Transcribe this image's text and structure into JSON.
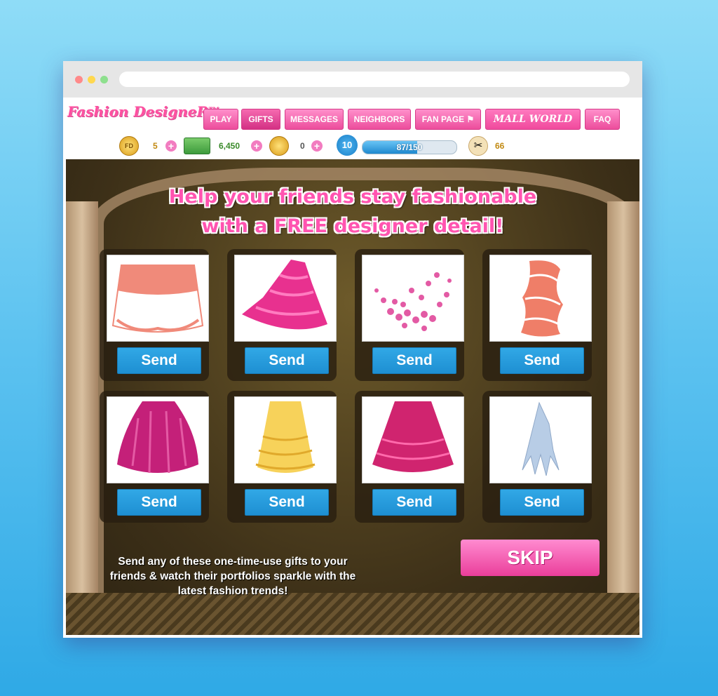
{
  "app": {
    "logo": "Fashion DesigneR",
    "trademark": "TM"
  },
  "nav": [
    {
      "label": "PLAY"
    },
    {
      "label": "GIFTS"
    },
    {
      "label": "MESSAGES"
    },
    {
      "label": "NEIGHBORS"
    },
    {
      "label": "FAN PAGE"
    },
    {
      "label": "MALL WORLD"
    },
    {
      "label": "FAQ"
    }
  ],
  "stats": {
    "fd_coin_label": "FD",
    "fd_coins": "5",
    "cash": "6,450",
    "facebook_credits": "0",
    "level": "10",
    "xp_text": "87/150",
    "xp_fraction": 0.58,
    "scissors": "66"
  },
  "headline": {
    "line1": "Help your friends stay fashionable",
    "line2": "with a FREE designer detail!"
  },
  "gifts": [
    {
      "send_label": "Send",
      "icon": "coral-white-skirt",
      "color": "#f08a7a"
    },
    {
      "send_label": "Send",
      "icon": "pink-ruffle-skirt",
      "color": "#e8318f"
    },
    {
      "send_label": "Send",
      "icon": "pink-sequin-floral",
      "color": "#e35aa4"
    },
    {
      "send_label": "Send",
      "icon": "coral-swirl-fabric",
      "color": "#ef7e68"
    },
    {
      "send_label": "Send",
      "icon": "magenta-bubble-skirt",
      "color": "#c42079"
    },
    {
      "send_label": "Send",
      "icon": "yellow-tiered-skirt",
      "color": "#f7d25a"
    },
    {
      "send_label": "Send",
      "icon": "magenta-tiered-skirt",
      "color": "#d0246f"
    },
    {
      "send_label": "Send",
      "icon": "icy-feather-fringe",
      "color": "#b8cde6"
    }
  ],
  "footer": {
    "message": "Send any of these one-time-use gifts to your friends & watch their portfolios sparkle with the latest fashion trends!",
    "skip_label": "SKIP"
  }
}
